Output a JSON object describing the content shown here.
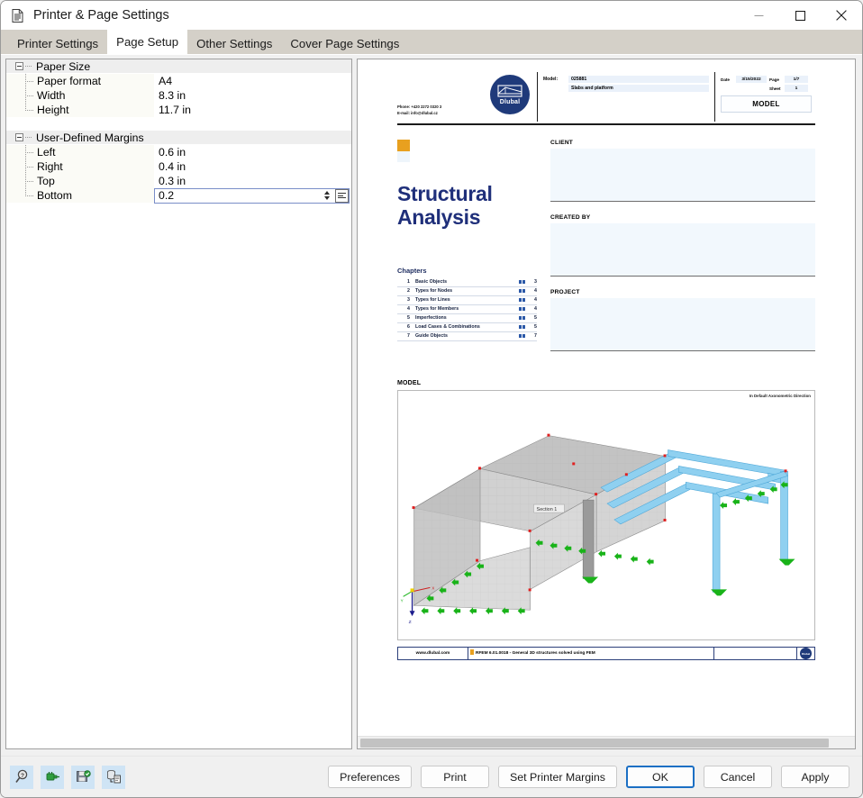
{
  "window": {
    "title": "Printer & Page Settings",
    "icon": "document-icon",
    "minimize_label": "–",
    "maximize_label": "☐",
    "close_label": "✕"
  },
  "tabs": [
    {
      "label": "Printer Settings",
      "active": false
    },
    {
      "label": "Page Setup",
      "active": true
    },
    {
      "label": "Other Settings",
      "active": false
    },
    {
      "label": "Cover Page Settings",
      "active": false
    }
  ],
  "property_grid": {
    "groups": [
      {
        "label": "Paper Size",
        "rows": [
          {
            "label": "Paper format",
            "value": "A4",
            "editing": false
          },
          {
            "label": "Width",
            "value": "8.3 in",
            "editing": false
          },
          {
            "label": "Height",
            "value": "11.7 in",
            "editing": false
          }
        ]
      },
      {
        "label": "User-Defined Margins",
        "rows": [
          {
            "label": "Left",
            "value": "0.6 in",
            "editing": false
          },
          {
            "label": "Right",
            "value": "0.4 in",
            "editing": false
          },
          {
            "label": "Top",
            "value": "0.3 in",
            "editing": false
          },
          {
            "label": "Bottom",
            "value": "0.2",
            "editing": true
          }
        ]
      }
    ]
  },
  "preview": {
    "header": {
      "contact_phone": "Phone: +420 2272 0320 3",
      "contact_email": "E-mail: info@dlubal.cz",
      "logo_text": "Dlubal",
      "model_key": "Model:",
      "model_number": "025881",
      "model_name": "Slabs and platform",
      "date_label": "Date",
      "date_value": "3/15/2022",
      "page_label": "Page",
      "page_value": "1/7",
      "sheet_label": "Sheet",
      "sheet_value": "1",
      "section_title": "MODEL"
    },
    "cover": {
      "title_line1": "Structural",
      "title_line2": "Analysis",
      "chapters_heading": "Chapters",
      "chapters": [
        {
          "num": "1",
          "name": "Basic Objects",
          "page": "3"
        },
        {
          "num": "2",
          "name": "Types for Nodes",
          "page": "4"
        },
        {
          "num": "3",
          "name": "Types for Lines",
          "page": "4"
        },
        {
          "num": "4",
          "name": "Types for Members",
          "page": "4"
        },
        {
          "num": "5",
          "name": "Imperfections",
          "page": "5"
        },
        {
          "num": "6",
          "name": "Load Cases & Combinations",
          "page": "5"
        },
        {
          "num": "7",
          "name": "Guide Objects",
          "page": "7"
        }
      ],
      "fields": [
        {
          "label": "CLIENT",
          "value": ""
        },
        {
          "label": "CREATED BY",
          "value": ""
        },
        {
          "label": "PROJECT",
          "value": ""
        }
      ]
    },
    "model_section": {
      "heading": "MODEL",
      "view_note": "In Default Axonometric Direction",
      "section_tag": "Section 1",
      "axis_z": "Z",
      "axis_y": "Y",
      "axis_x": "X"
    },
    "footer": {
      "website": "www.dlubal.com",
      "version": "RFEM 6.01.0018 - General 3D structures solved using FEM",
      "logo_text": "Dlubal"
    }
  },
  "toolbar_icons": [
    {
      "name": "zoom-icon",
      "glyph": "⌕"
    },
    {
      "name": "plug-icon",
      "glyph": "⚡"
    },
    {
      "name": "save-settings-icon",
      "glyph": "ὋE"
    },
    {
      "name": "database-icon",
      "glyph": "≡"
    }
  ],
  "buttons": {
    "preferences": "Preferences",
    "print": "Print",
    "set_printer_margins": "Set Printer Margins",
    "ok": "OK",
    "cancel": "Cancel",
    "apply": "Apply"
  },
  "colors": {
    "accent_blue": "#1b6fc4",
    "dlubal_navy": "#1f3a7a",
    "title_navy": "#1f2f7a",
    "orange": "#e8a01f",
    "field_fill": "#f2f8fd",
    "member_blue": "#7ec8f0",
    "support_green": "#17b317",
    "node_red": "#e02020"
  }
}
